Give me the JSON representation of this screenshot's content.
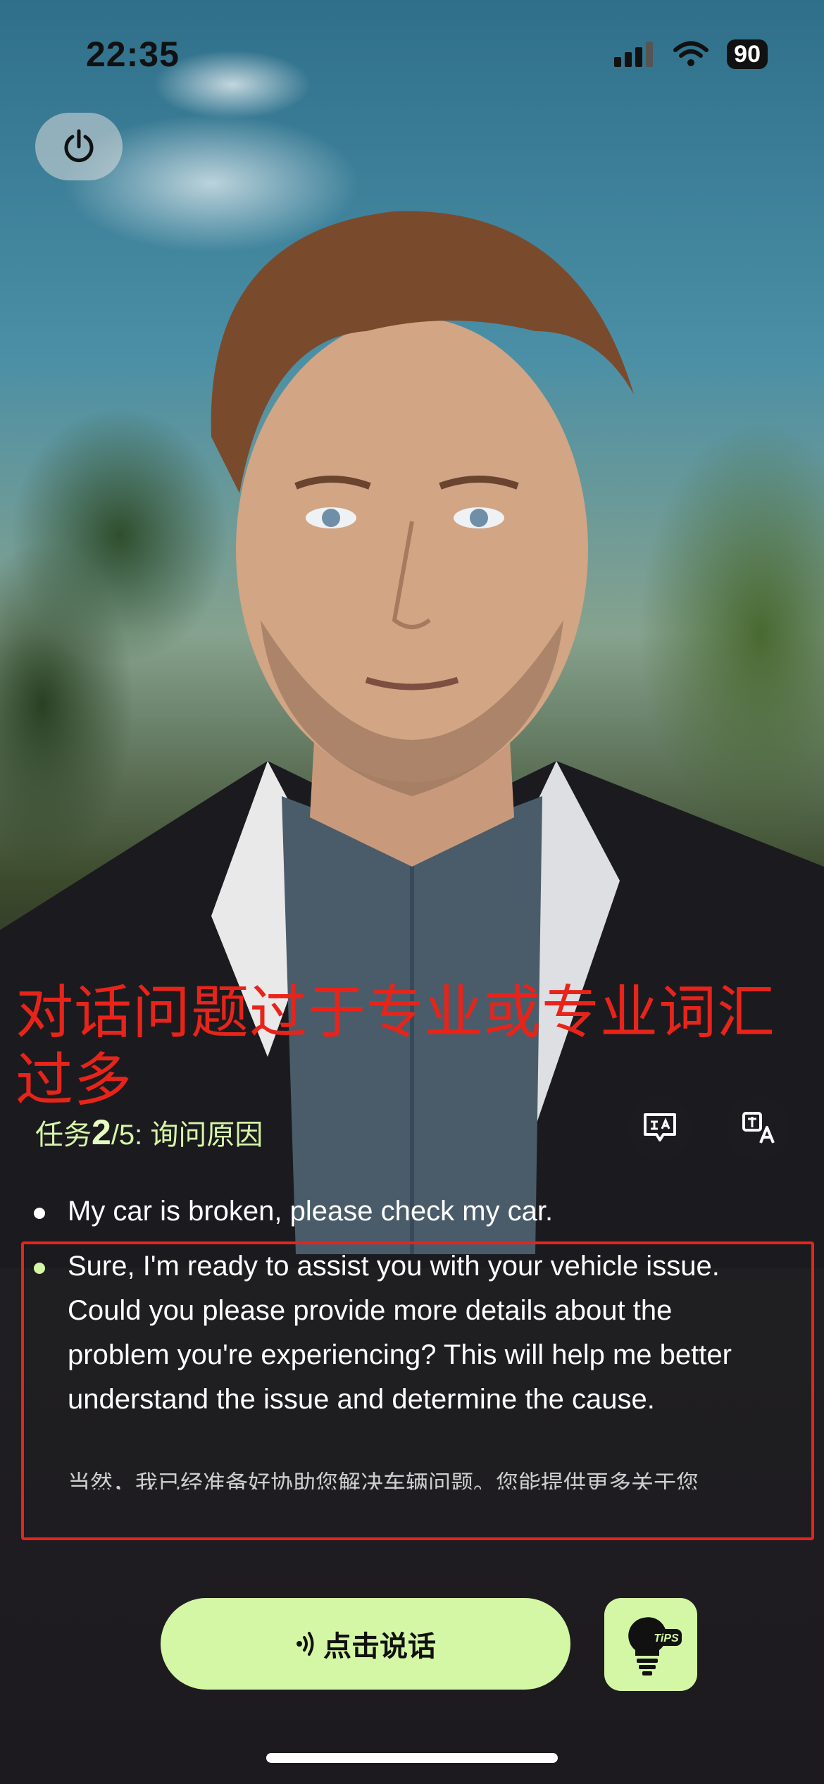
{
  "status_bar": {
    "time": "22:35",
    "battery": "90"
  },
  "annotation": {
    "text": "对话问题过于专业或专业词汇过多"
  },
  "task": {
    "prefix": "任务",
    "current": "2",
    "total": "/5",
    "name": ": 询问原因"
  },
  "messages": [
    {
      "role": "user",
      "text": "My car is broken, please check my car."
    },
    {
      "role": "assistant",
      "text": "Sure, I'm ready to assist you with your vehicle issue. Could you please provide more details about the problem you're experiencing? This will help me better understand the issue and determine the cause.",
      "translation": "当然，我已经准备好协助您解决车辆问题。您能提供更多关于您"
    }
  ],
  "controls": {
    "speak_label": "点击说话",
    "tips_label": "TiPS"
  },
  "colors": {
    "accent": "#d4f7a6",
    "annotation_red": "#e8241a",
    "user_bullet": "#ffffff",
    "assistant_bullet": "#d4f7a6"
  },
  "icons": [
    "power-icon",
    "subtitle-icon",
    "translate-icon",
    "sound-wave-icon",
    "lightbulb-tips-icon",
    "signal-icon",
    "wifi-icon",
    "battery-icon"
  ]
}
